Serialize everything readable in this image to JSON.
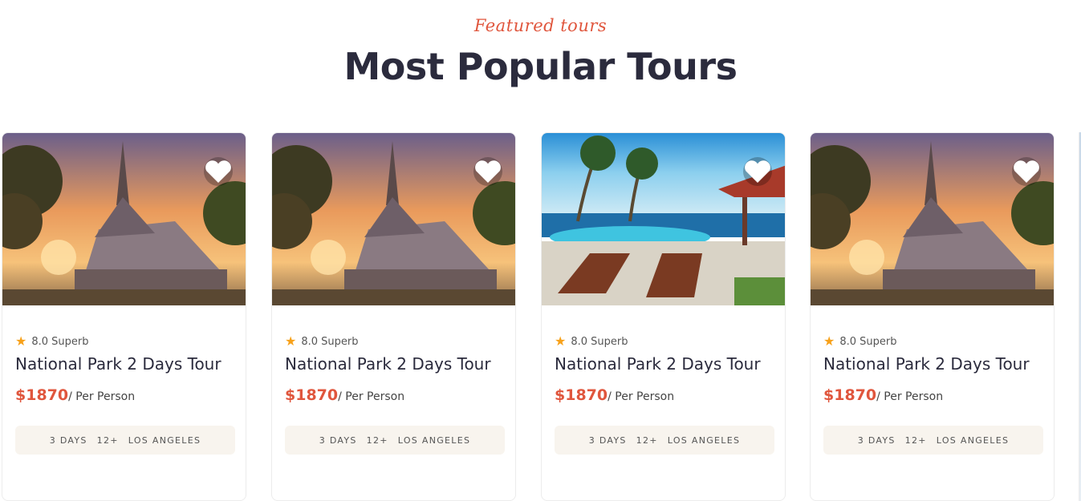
{
  "header": {
    "subtitle": "Featured tours",
    "title": "Most Popular Tours"
  },
  "tours": [
    {
      "image": "temple-sunset",
      "rating": "8.0 Superb",
      "name": "National Park 2 Days Tour",
      "price": "$1870",
      "price_unit": "/ Per Person",
      "days": "3 DAYS",
      "age": "12+",
      "location": "LOS ANGELES"
    },
    {
      "image": "temple-sunset",
      "rating": "8.0 Superb",
      "name": "National Park 2 Days Tour",
      "price": "$1870",
      "price_unit": "/ Per Person",
      "days": "3 DAYS",
      "age": "12+",
      "location": "LOS ANGELES"
    },
    {
      "image": "tropical-pool",
      "rating": "8.0 Superb",
      "name": "National Park 2 Days Tour",
      "price": "$1870",
      "price_unit": "/ Per Person",
      "days": "3 DAYS",
      "age": "12+",
      "location": "LOS ANGELES"
    },
    {
      "image": "temple-sunset",
      "rating": "8.0 Superb",
      "name": "National Park 2 Days Tour",
      "price": "$1870",
      "price_unit": "/ Per Person",
      "days": "3 DAYS",
      "age": "12+",
      "location": "LOS ANGELES"
    }
  ],
  "icons": {
    "star": "star-icon",
    "wishlist": "heart-icon"
  },
  "colors": {
    "accent": "#e0563d",
    "star": "#f7a11a",
    "meta_bg": "#f8f4ee",
    "title": "#2b2b3d"
  }
}
